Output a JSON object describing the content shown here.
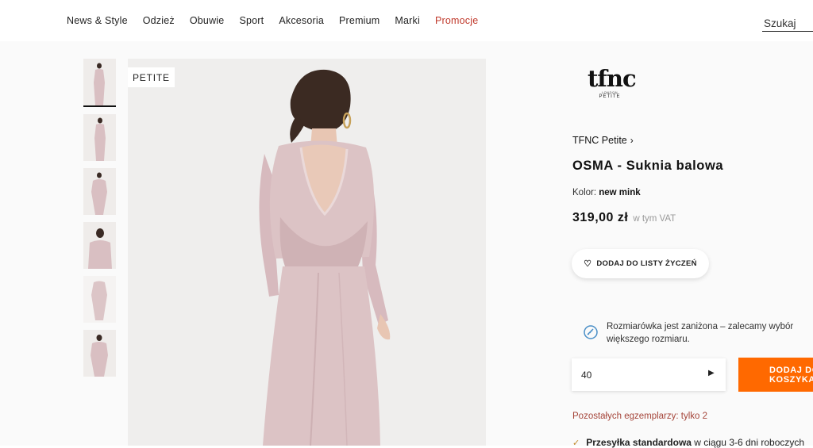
{
  "nav": {
    "items": [
      {
        "label": "News & Style"
      },
      {
        "label": "Odzież"
      },
      {
        "label": "Obuwie"
      },
      {
        "label": "Sport"
      },
      {
        "label": "Akcesoria"
      },
      {
        "label": "Premium"
      },
      {
        "label": "Marki"
      },
      {
        "label": "Promocje"
      }
    ],
    "search_placeholder": "Szukaj"
  },
  "gallery": {
    "badge": "PETITE",
    "thumbnail_count": 6,
    "active_index": 0
  },
  "brand_logo": {
    "main": "tfnc",
    "line1": "LONDON",
    "line2": "PETITE"
  },
  "product": {
    "brand_link": "TFNC Petite",
    "title": "OSMA - Suknia balowa",
    "color_label": "Kolor:",
    "color_value": "new mink",
    "price": "319,00 zł",
    "vat_note": "w tym VAT",
    "wishlist_label": "DODAJ DO LISTY ŻYCZEŃ",
    "size_note": "Rozmiarówka jest zaniżona – zalecamy wybór większego rozmiaru.",
    "size_value": "40",
    "add_button": "DODAJ DO KOSZYKA",
    "stock_note": "Pozostałych egzemplarzy: tylko 2",
    "shipping_bold": "Przesyłka standardowa",
    "shipping_rest": "w ciągu 3-6 dni roboczych"
  },
  "colors": {
    "accent": "#ff6900",
    "promo": "#c0392b",
    "dress": "#d9bfc2"
  }
}
